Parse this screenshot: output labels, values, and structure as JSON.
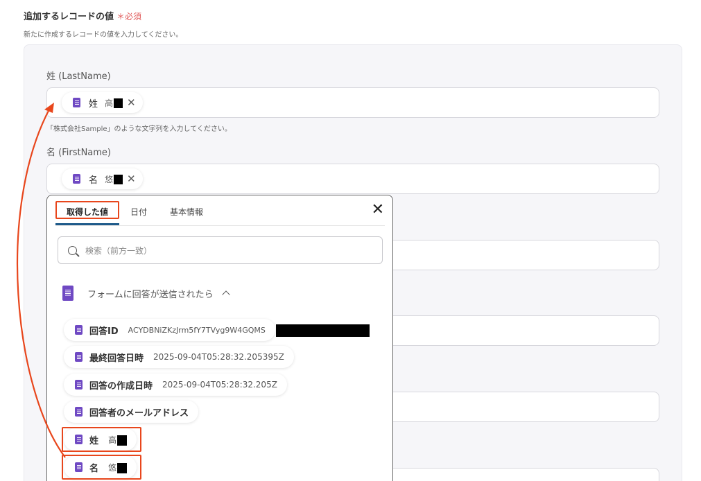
{
  "section": {
    "title": "追加するレコードの値",
    "required": "＊必須",
    "description": "新たに作成するレコードの値を入力してください。"
  },
  "fields": {
    "lastname": {
      "label": "姓 (LastName)",
      "chip_label": "姓",
      "chip_value": "高",
      "hint": "「株式会社Sample」のような文字列を入力してください。"
    },
    "firstname": {
      "label": "名 (FirstName)",
      "chip_label": "名",
      "chip_value": "悠"
    }
  },
  "popup": {
    "tabs": [
      "取得した値",
      "日付",
      "基本情報"
    ],
    "search_placeholder": "検索（前方一致）",
    "group_title": "フォームに回答が送信されたら",
    "items": [
      {
        "label": "回答ID",
        "value": "ACYDBNiZKzJrm5fY7TVyg9W4GQMS"
      },
      {
        "label": "最終回答日時",
        "value": "2025-09-04T05:28:32.205395Z"
      },
      {
        "label": "回答の作成日時",
        "value": "2025-09-04T05:28:32.205Z"
      },
      {
        "label": "回答者のメールアドレス",
        "value": ""
      },
      {
        "label": "姓",
        "value": "高"
      },
      {
        "label": "名",
        "value": "悠"
      }
    ]
  },
  "colors": {
    "accent": "#e8461c",
    "doc_icon": "#6f49c3",
    "tab_underline": "#1e5a8a",
    "required": "#e05a5a"
  },
  "icons": {
    "doc": "form-doc-icon",
    "close": "close-icon",
    "search": "search-icon",
    "chevron": "chevron-up-icon"
  }
}
